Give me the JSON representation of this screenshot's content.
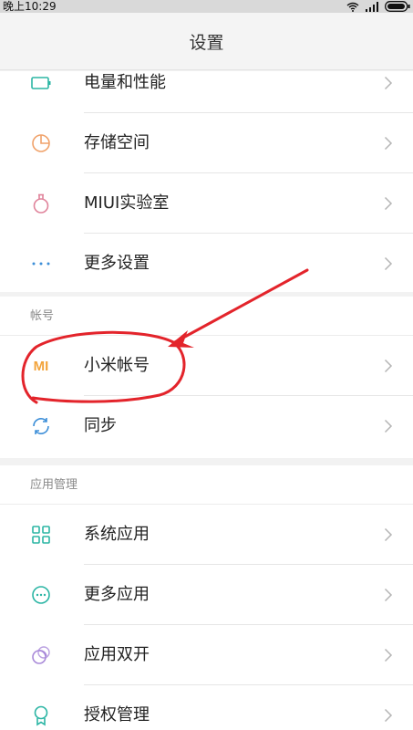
{
  "status_bar": {
    "time": "晚上10:29",
    "icons": [
      "wifi-icon",
      "signal-icon",
      "battery-icon"
    ]
  },
  "header": {
    "title": "设置"
  },
  "groups": [
    {
      "items": [
        {
          "label": "电量和性能",
          "icon": "battery-outline-icon"
        },
        {
          "label": "存储空间",
          "icon": "pie-chart-icon"
        },
        {
          "label": "MIUI实验室",
          "icon": "flask-icon"
        },
        {
          "label": "更多设置",
          "icon": "more-dots-icon"
        }
      ]
    },
    {
      "header": "帐号",
      "items": [
        {
          "label": "小米帐号",
          "icon": "mi-logo-icon"
        },
        {
          "label": "同步",
          "icon": "sync-icon"
        }
      ]
    },
    {
      "header": "应用管理",
      "items": [
        {
          "label": "系统应用",
          "icon": "grid-icon"
        },
        {
          "label": "更多应用",
          "icon": "more-apps-icon"
        },
        {
          "label": "应用双开",
          "icon": "dual-app-icon"
        },
        {
          "label": "授权管理",
          "icon": "shield-badge-icon"
        }
      ]
    }
  ],
  "logo_text": "MI",
  "colors": {
    "icon_teal": "#2bb5a4",
    "icon_orange": "#f0a26a",
    "icon_pink": "#e0839b",
    "icon_blue": "#3d8fd8",
    "mi_orange": "#f2a33a",
    "annotation_red": "#e3242b"
  }
}
